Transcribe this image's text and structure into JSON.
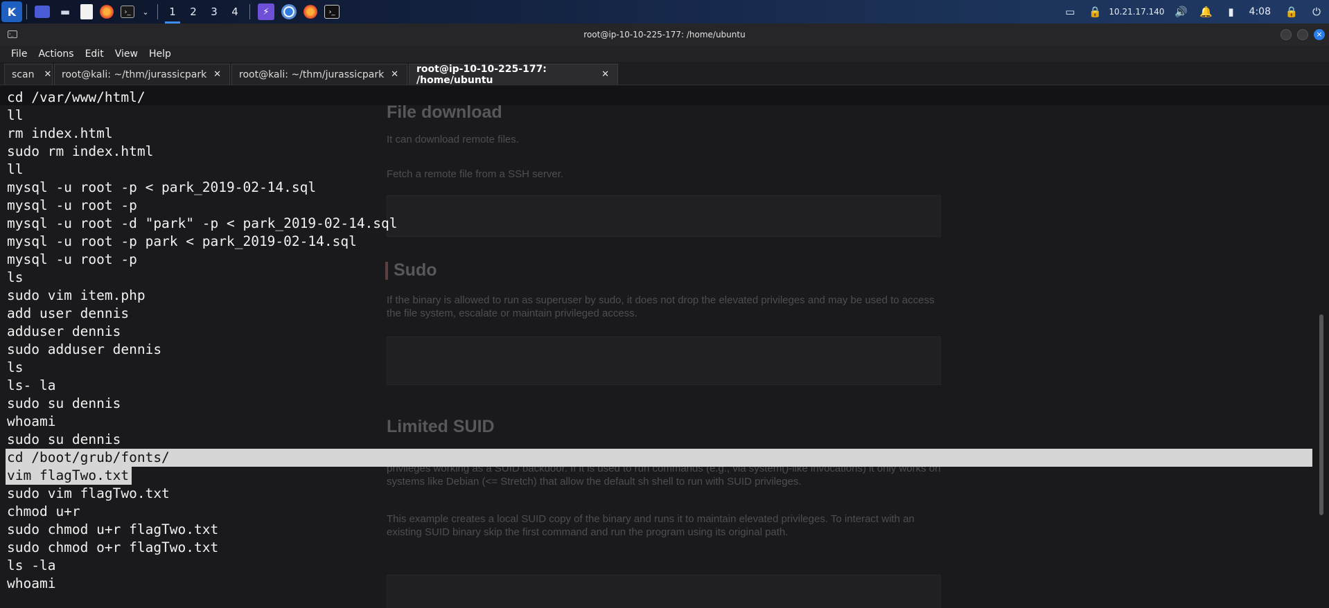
{
  "panel": {
    "workspaces": [
      "1",
      "2",
      "3",
      "4"
    ],
    "active_workspace": 0,
    "ip_address": "10.21.17.140",
    "clock": "4:08",
    "icons": [
      "kali-dragon-icon",
      "desktop-icon",
      "file-manager-icon",
      "text-editor-icon",
      "firefox-icon",
      "terminal-icon",
      "chevron-down-icon",
      "burp-icon",
      "chromium-icon",
      "firefox-icon",
      "terminal-icon"
    ]
  },
  "window": {
    "title": "root@ip-10-10-225-177: /home/ubuntu"
  },
  "menu": {
    "items": [
      "File",
      "Actions",
      "Edit",
      "View",
      "Help"
    ]
  },
  "tabs": [
    {
      "label": "scan",
      "active": false
    },
    {
      "label": "root@kali: ~/thm/jurassicpark",
      "active": false
    },
    {
      "label": "root@kali: ~/thm/jurassicpark",
      "active": false
    },
    {
      "label": "root@ip-10-10-225-177: /home/ubuntu",
      "active": true
    }
  ],
  "terminal": {
    "lines": [
      "cd /var/www/html/",
      "ll",
      "rm index.html",
      "sudo rm index.html",
      "ll",
      "mysql -u root -p < park_2019-02-14.sql",
      "mysql -u root -p",
      "mysql -u root -d \"park\" -p < park_2019-02-14.sql",
      "mysql -u root -p park < park_2019-02-14.sql",
      "mysql -u root -p",
      "ls",
      "sudo vim item.php",
      "add user dennis",
      "adduser dennis",
      "sudo adduser dennis",
      "ls",
      "ls- la",
      "sudo su dennis",
      "whoami",
      "sudo su dennis",
      "cd /boot/grub/fonts/",
      "vim flagTwo.txt",
      "sudo vim flagTwo.txt",
      "chmod u+r",
      "sudo chmod u+r flagTwo.txt",
      "sudo chmod o+r flagTwo.txt",
      "ls -la",
      "whoami"
    ],
    "selected_full_line": 20,
    "selected_partial_line": 21
  },
  "background_page": {
    "heading_file_download": "File download",
    "text_file_download": "It can download remote files.",
    "text_fetch": "Fetch a remote file from a SSH server.",
    "heading_sudo": "Sudo",
    "text_sudo": "If the binary is allowed to run as superuser by sudo, it does not drop the elevated privileges and may be used to access the file system, escalate or maintain privileged access.",
    "heading_suid": "Limited SUID",
    "text_suid": "If the binary has the SUID bit set, it may be abused to access the file system, escalate or maintain access with elevated privileges working as a SUID backdoor. If it is used to run commands (e.g., via system()-like invocations) it only works on systems like Debian (<= Stretch) that allow the default sh shell to run with SUID privileges.",
    "text_example": "This example creates a local SUID copy of the binary and runs it to maintain elevated privileges. To interact with an existing SUID binary skip the first command and run the program using its original path."
  },
  "colors": {
    "accent": "#3b8ef0",
    "terminal_bg": "#1a1a1d",
    "selection": "#d6d6d6"
  }
}
